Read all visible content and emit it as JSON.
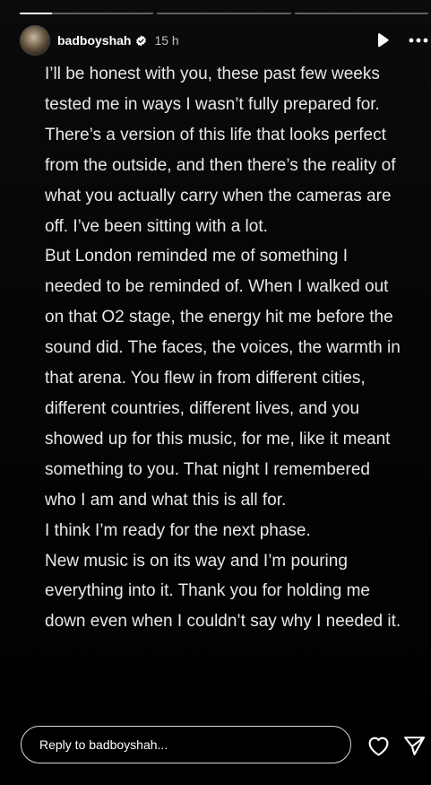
{
  "progress": [
    {
      "state": "viewed",
      "fill_fraction": 0.24
    },
    {
      "state": "pending",
      "fill_fraction": 0
    },
    {
      "state": "pending",
      "fill_fraction": 0
    }
  ],
  "header": {
    "username": "badboyshah",
    "verified": true,
    "time": "15 h",
    "play_icon": "play-icon",
    "more_icon": "more-icon"
  },
  "post": {
    "paragraphs": [
      "I’ll be honest with you, these past few weeks tested me in ways I wasn’t fully prepared for. There’s a version of this life that looks perfect from the outside, and then there’s the reality of what you actually carry when the cameras are off. I’ve been sitting with a lot.",
      "But London reminded me of something I needed to be reminded of. When I walked out on that O2 stage, the energy hit me before the sound did. The faces, the voices, the warmth in that arena. You flew in from different cities, different countries, different lives, and you showed up for this music, for me, like it meant something to you. That night I remembered who I am and what this is all for.",
      "I think I’m ready for the next phase.",
      "New music is on its way and I’m pouring everything into it. Thank you for holding me down even when I couldn’t say why I needed it."
    ]
  },
  "footer": {
    "reply_placeholder": "Reply to badboyshah...",
    "like_icon": "heart-icon",
    "share_icon": "send-icon"
  },
  "colors": {
    "background": "#000000",
    "text": "#e8e8e8",
    "verified_badge": "#ffffff"
  }
}
